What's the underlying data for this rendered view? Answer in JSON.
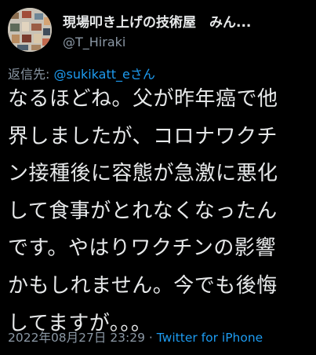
{
  "user": {
    "display_name": "現場叩き上げの技術屋　みん...",
    "handle": "@T_Hiraki",
    "avatar": "avatar-icon"
  },
  "reply": {
    "prefix": "返信先: ",
    "target": "@sukikatt_eさん"
  },
  "tweet": {
    "text": "なるほどね。父が昨年癌で他\n界しましたが、コロナワクチ\nン接種後に容態が急激に悪化\nして食事がとれなくなったん\nです。やはりワクチンの影響\nかもしれません。今でも後悔\nしてますが。。。"
  },
  "meta": {
    "timestamp": "2022年08月27日 23:29",
    "separator": " · ",
    "source": "Twitter for iPhone"
  },
  "colors": {
    "background": "#000000",
    "text": "#e7e9ea",
    "muted": "#8b98a5",
    "link": "#1d9bf0"
  }
}
